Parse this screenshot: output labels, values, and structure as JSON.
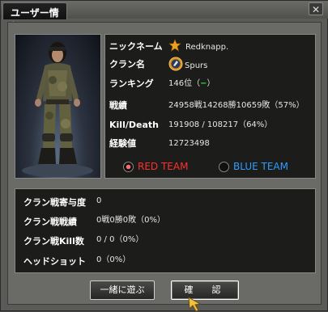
{
  "window": {
    "title": "ユーザー情報",
    "close_glyph": "✕"
  },
  "profile": {
    "rows": [
      {
        "label": "ニックネーム",
        "value": "Redknapp."
      },
      {
        "label": "クラン名",
        "value": "Spurs"
      },
      {
        "label": "ランキング",
        "value": "146位（",
        "badge": "−",
        "suffix": "）"
      },
      {
        "label": "戦績",
        "value": "24958戦14268勝10659敗（57%）"
      },
      {
        "label": "Kill/Death",
        "value": "191908 / 108217（64%）"
      },
      {
        "label": "経験値",
        "value": "12723498"
      }
    ],
    "teams": {
      "red": "RED TEAM",
      "blue": "BLUE TEAM",
      "selected": "red"
    }
  },
  "clan_stats": {
    "rows": [
      {
        "label": "クラン戦寄与度",
        "value": "0"
      },
      {
        "label": "クラン戦戦績",
        "value": "0戦0勝0敗（0%）"
      },
      {
        "label": "クラン戦Kill数",
        "value": "0 / 0（0%）"
      },
      {
        "label": "ヘッドショット",
        "value": "0（0%）"
      }
    ]
  },
  "buttons": {
    "play_together": "一緒に遊ぶ",
    "confirm": "確　認"
  },
  "icons": {
    "nickname": "star-rank-icon",
    "clan": "clan-emblem-icon",
    "cursor": "pointer-cursor-icon"
  },
  "colors": {
    "red_team": "#ff3030",
    "blue_team": "#2f9cff",
    "rank_change": "#2ee52e"
  }
}
